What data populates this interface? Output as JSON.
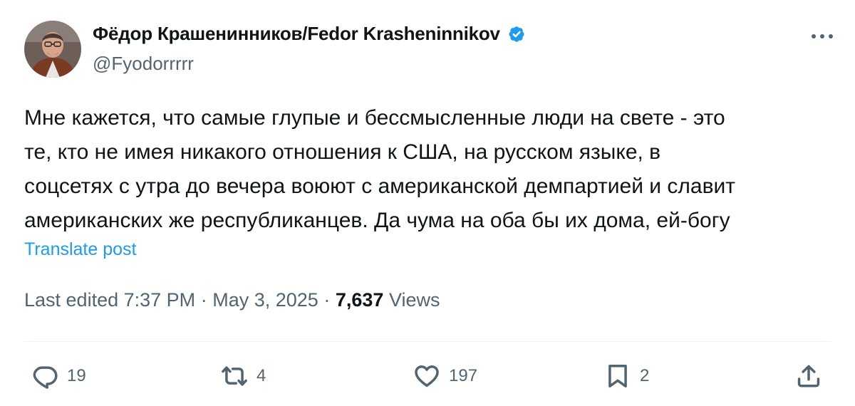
{
  "author": {
    "display_name": "Фёдор Крашенинников/Fedor Krasheninnikov",
    "handle": "@Fyodorrrrr",
    "verified": true,
    "avatar_icon": "profile-photo",
    "verified_icon": "verified-badge-icon"
  },
  "tweet": {
    "text_lines": [
      "Мне кажется, что самые глупые и бессмысленные люди на свете - это",
      "те, кто не имея никакого отношения к США, на русском языке, в",
      "соцсетях с утра до вечера воюют с американской демпартией и славит",
      "американских же республиканцев. Да чума на оба бы их дома, ей-богу"
    ],
    "translate_label": "Translate post"
  },
  "meta": {
    "edited_label": "Last edited",
    "time": "7:37 PM",
    "separator": "·",
    "date": "May 3, 2025",
    "views_count": "7,637",
    "views_label": "Views"
  },
  "actions": {
    "reply": {
      "icon": "reply-icon",
      "count": "19"
    },
    "repost": {
      "icon": "repost-icon",
      "count": "4"
    },
    "like": {
      "icon": "heart-icon",
      "count": "197"
    },
    "bookmark": {
      "icon": "bookmark-icon",
      "count": "2"
    },
    "share": {
      "icon": "share-icon"
    }
  },
  "colors": {
    "text": "#0f1419",
    "secondary": "#536471",
    "link": "#1d9bf0",
    "verified": "#1d9bf0",
    "divider": "#eff3f4"
  }
}
